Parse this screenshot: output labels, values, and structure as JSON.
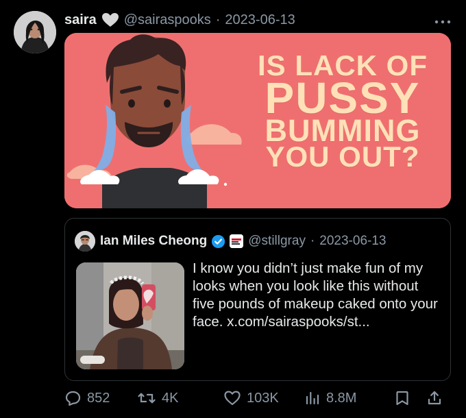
{
  "post": {
    "author_name": "saira",
    "heart_badge_icon": "heart-icon",
    "handle": "@sairaspooks",
    "separator": "·",
    "date": "2023-06-13",
    "more_icon": "more-icon",
    "media": {
      "line1": "IS LACK OF",
      "line2": "PUSSY",
      "line3": "BUMMING",
      "line4": "YOU OUT?"
    }
  },
  "quoted": {
    "author_name": "Ian Miles Cheong",
    "verified_icon": "verified-check-icon",
    "affiliate_icon": "affiliate-badge-icon",
    "handle": "@stillgray",
    "separator": "·",
    "date": "2023-06-13",
    "text": "I know you didn’t just make fun of my looks when you look like this without five pounds of makeup caked onto your face. x.com/sairaspooks/st..."
  },
  "actions": {
    "replies": "852",
    "reposts": "4K",
    "likes": "103K",
    "views": "8.8M",
    "reply_icon": "reply-icon",
    "repost_icon": "repost-icon",
    "like_icon": "like-icon",
    "views_icon": "views-icon",
    "bookmark_icon": "bookmark-icon",
    "share_icon": "share-icon"
  }
}
